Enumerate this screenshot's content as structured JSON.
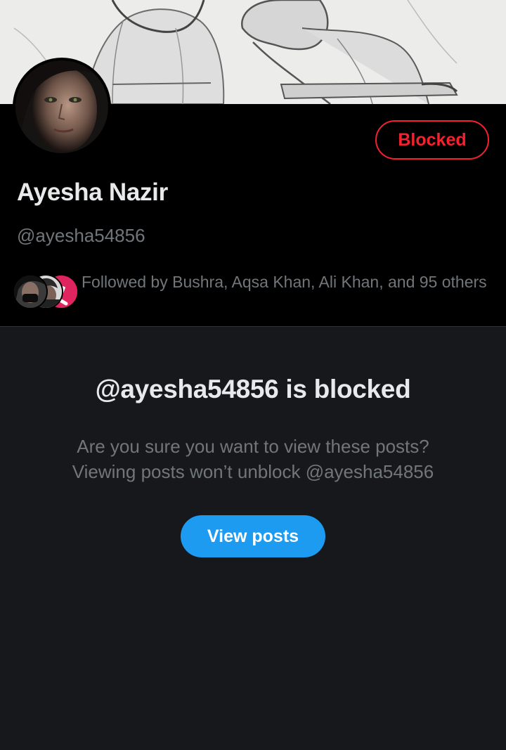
{
  "profile": {
    "display_name": "Ayesha Nazir",
    "handle": "@ayesha54856",
    "blocked_button_label": "Blocked",
    "followed_by_text": "Followed by Bushra, Aqsa Khan, Ali Khan, and 95 others"
  },
  "blocked_notice": {
    "title": "@ayesha54856 is blocked",
    "line1": "Are you sure you want to view these posts?",
    "line2": "Viewing posts won’t unblock @ayesha54856",
    "view_posts_label": "View posts"
  },
  "colors": {
    "header_bg": "#000000",
    "content_bg": "#16181c",
    "blocked_red": "#f4212e",
    "accent_blue": "#1d9bf0",
    "text_primary": "#e7e9ea",
    "text_secondary": "#71767b"
  }
}
